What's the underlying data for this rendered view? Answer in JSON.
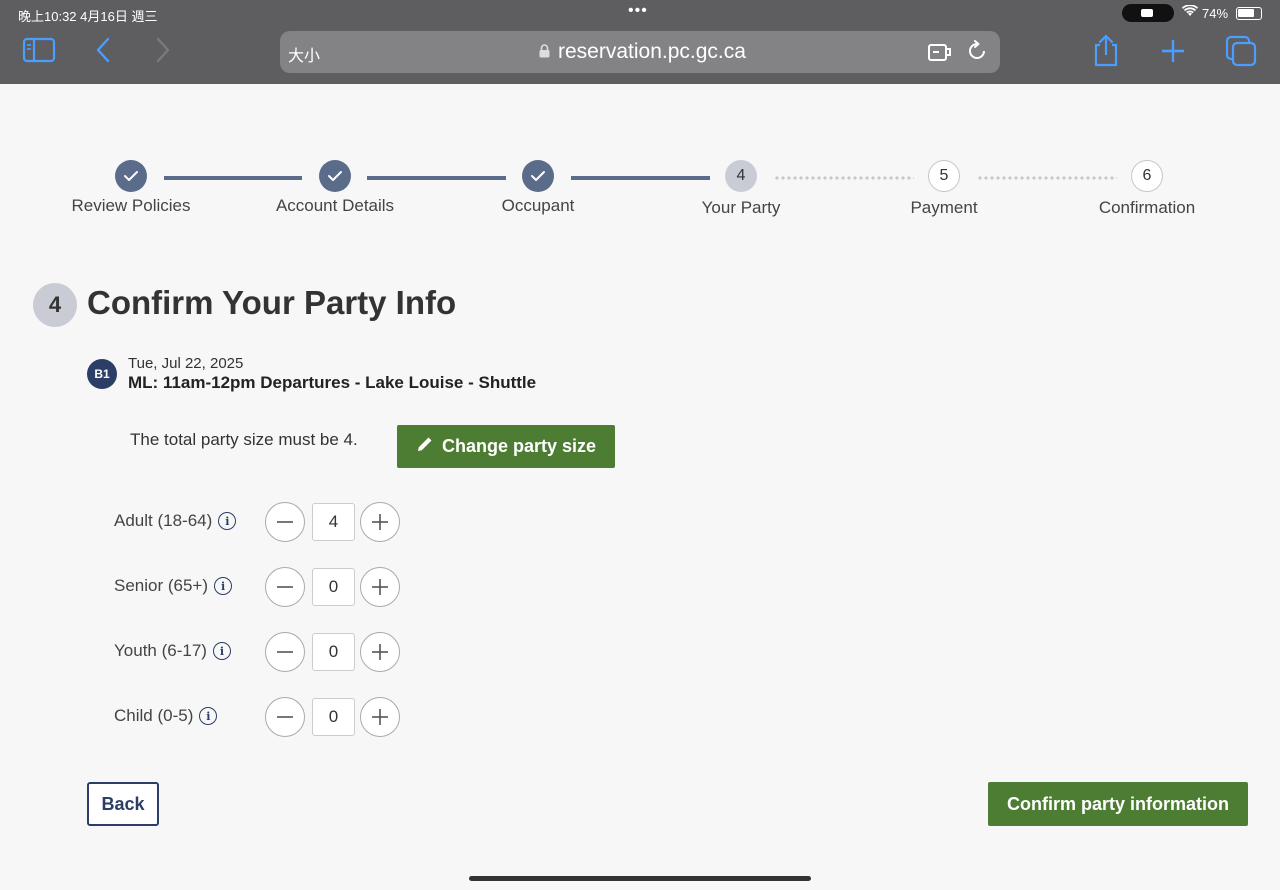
{
  "status_bar": {
    "time": "晚上10:32   4月16日 週三",
    "dots": "•••",
    "battery": "74%"
  },
  "browser": {
    "text_size": "大小",
    "url": "reservation.pc.gc.ca"
  },
  "progress": {
    "steps": [
      {
        "label": "Review Policies",
        "state": "done",
        "number": ""
      },
      {
        "label": "Account Details",
        "state": "done",
        "number": ""
      },
      {
        "label": "Occupant",
        "state": "done",
        "number": ""
      },
      {
        "label": "Your Party",
        "state": "current",
        "number": "4"
      },
      {
        "label": "Payment",
        "state": "todo",
        "number": "5"
      },
      {
        "label": "Confirmation",
        "state": "todo",
        "number": "6"
      }
    ]
  },
  "heading": {
    "number": "4",
    "title": "Confirm Your Party Info"
  },
  "booking": {
    "badge": "B1",
    "date": "Tue, Jul 22, 2025",
    "description": "ML: 11am-12pm Departures - Lake Louise - Shuttle"
  },
  "party": {
    "total_text": "The total party size must be 4.",
    "change_button": "Change party size",
    "rows": [
      {
        "label": "Adult (18-64)",
        "value": "4"
      },
      {
        "label": "Senior (65+)",
        "value": "0"
      },
      {
        "label": "Youth (6-17)",
        "value": "0"
      },
      {
        "label": "Child (0-5)",
        "value": "0"
      }
    ]
  },
  "actions": {
    "back": "Back",
    "confirm": "Confirm party information"
  },
  "colors": {
    "primary_green": "#4d7d32",
    "navy": "#2c3e66",
    "step_done": "#5a6c8a",
    "chrome": "#5e5e60"
  }
}
